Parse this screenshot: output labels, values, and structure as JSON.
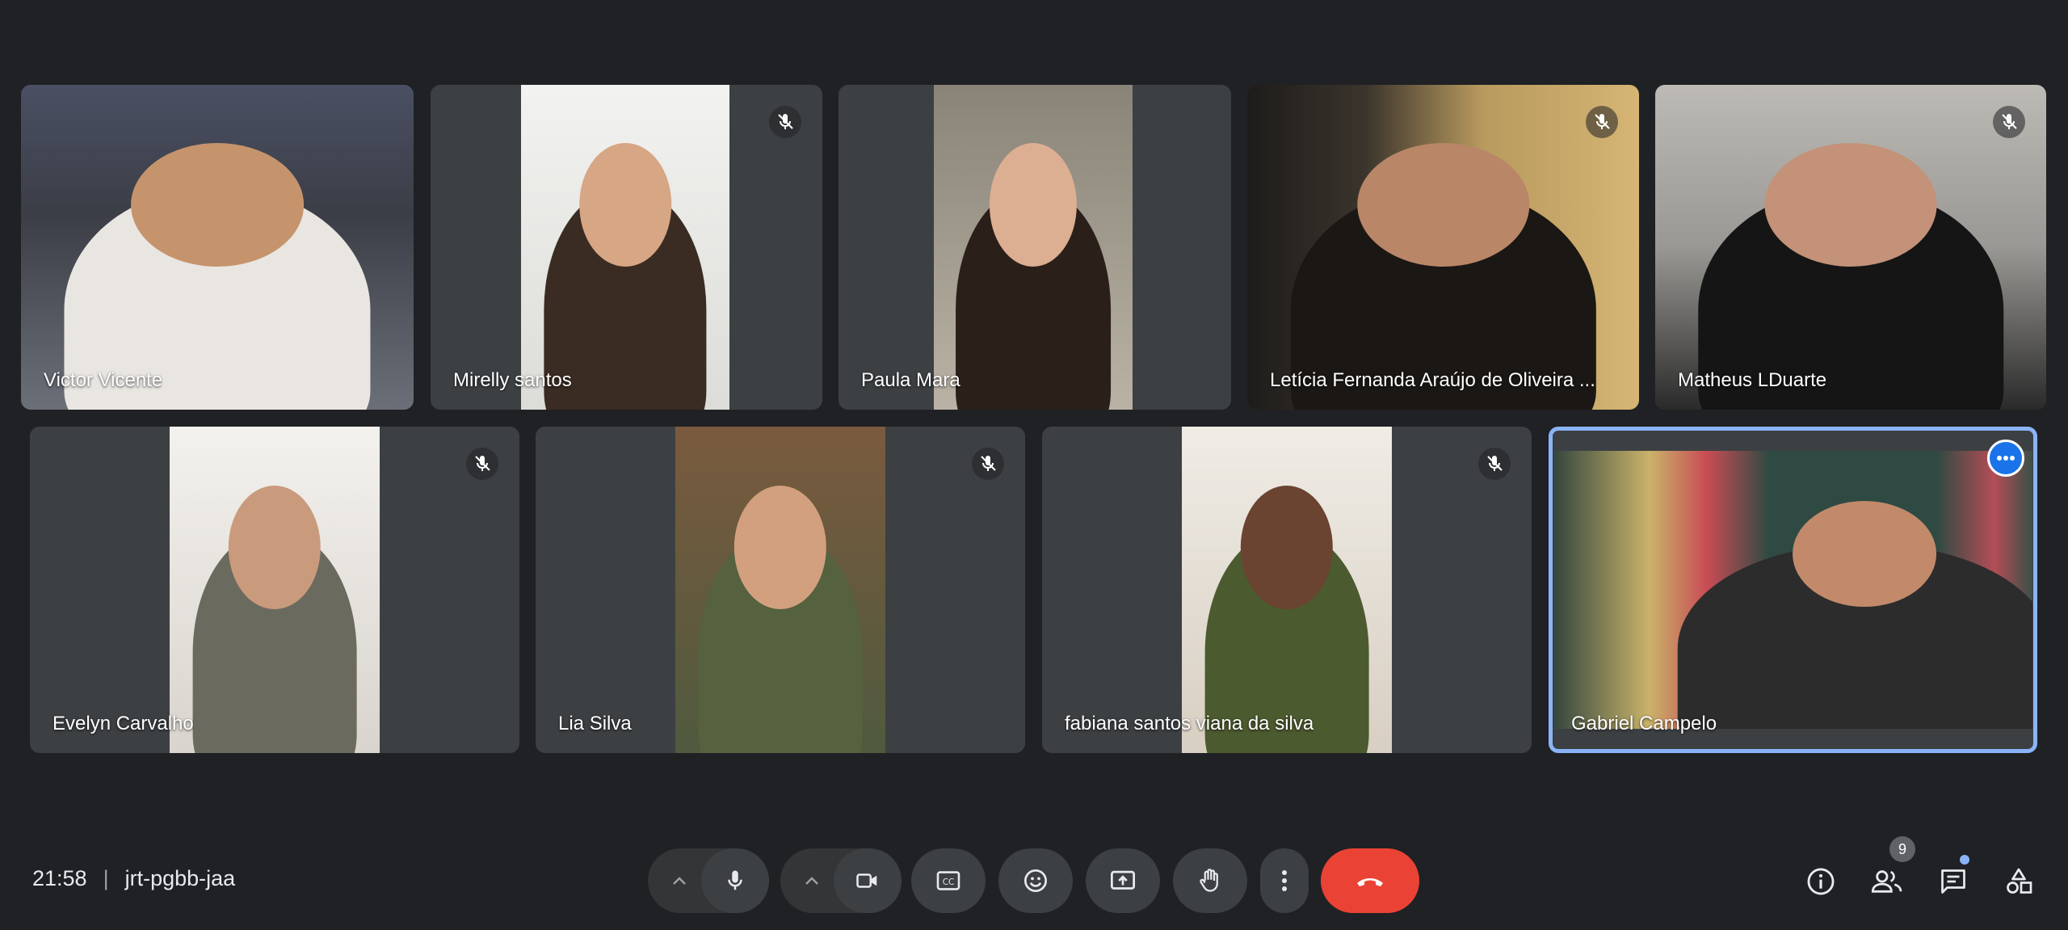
{
  "meeting": {
    "time": "21:58",
    "code": "jrt-pgbb-jaa",
    "participant_count": "9"
  },
  "participants": [
    {
      "name": "Victor Vicente",
      "muted": false
    },
    {
      "name": "Mirelly santos",
      "muted": true
    },
    {
      "name": "Paula Mara",
      "muted": false
    },
    {
      "name": "Letícia Fernanda Araújo de Oliveira ...",
      "muted": true
    },
    {
      "name": "Matheus LDuarte",
      "muted": true
    },
    {
      "name": "Evelyn Carvalho",
      "muted": true
    },
    {
      "name": "Lia Silva",
      "muted": true
    },
    {
      "name": "fabiana santos viana da silva",
      "muted": true
    },
    {
      "name": "Gabriel Campelo",
      "muted": false,
      "active_speaker": true
    }
  ],
  "controls": [
    "mic-options",
    "microphone",
    "camera-options",
    "camera",
    "captions",
    "reactions",
    "present-screen",
    "raise-hand",
    "more-options",
    "leave-call"
  ],
  "right_controls": [
    "meeting-details",
    "people",
    "chat",
    "activities"
  ],
  "colors": {
    "background": "#202124",
    "tile": "#3c4043",
    "active_border": "#8ab4f8",
    "leave": "#ea4335",
    "accent": "#1a73e8"
  }
}
